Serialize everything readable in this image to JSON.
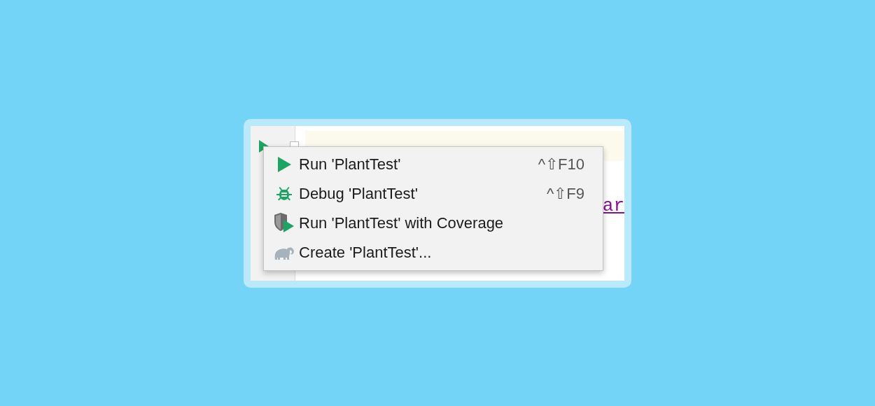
{
  "editor": {
    "lines": [
      {
        "current": true
      },
      {
        "current": false
      },
      {
        "current": false,
        "text": "ar"
      },
      {
        "current": false
      },
      {
        "current": false
      }
    ]
  },
  "menu": {
    "items": [
      {
        "kind": "run",
        "label": "Run 'PlantTest'",
        "shortcut": "^⇧F10"
      },
      {
        "kind": "debug",
        "label": "Debug 'PlantTest'",
        "shortcut": "^⇧F9"
      },
      {
        "kind": "coverage",
        "label": "Run 'PlantTest' with Coverage"
      },
      {
        "kind": "create",
        "label": "Create 'PlantTest'..."
      }
    ]
  }
}
